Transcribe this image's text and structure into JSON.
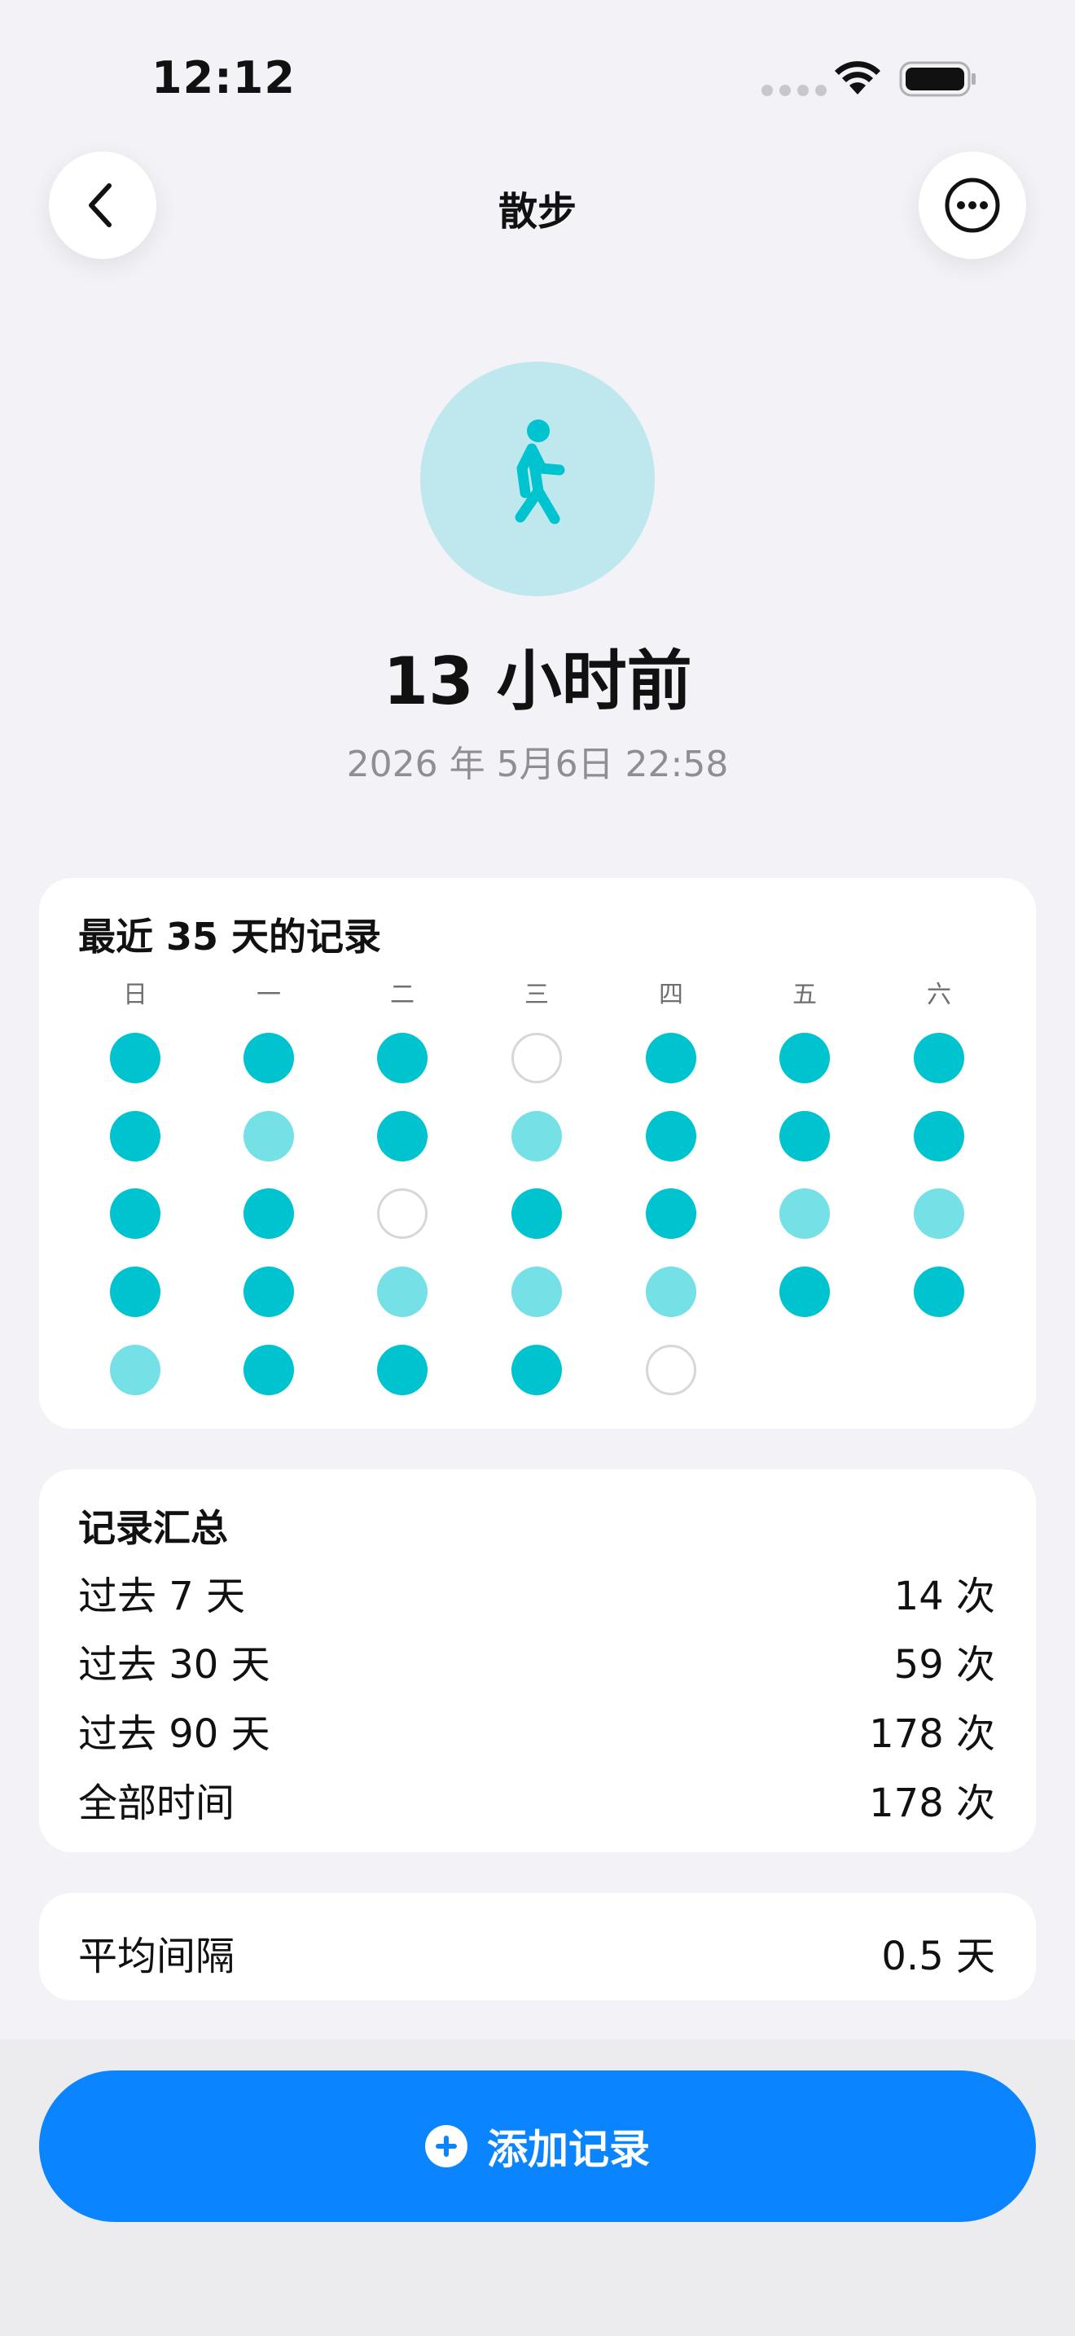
{
  "status_bar": {
    "time": "12:12"
  },
  "nav": {
    "title": "散步"
  },
  "activity": {
    "icon": "walking-person-icon",
    "last_time": "13 小时前",
    "last_date": "2026 年 5月6日 22:58"
  },
  "calendar": {
    "title": "最近 35 天的记录",
    "weekdays": [
      "日",
      "一",
      "二",
      "三",
      "四",
      "五",
      "六"
    ],
    "rows": [
      [
        "full",
        "full",
        "full",
        "empty",
        "full",
        "full",
        "full"
      ],
      [
        "full",
        "light",
        "full",
        "light",
        "full",
        "full",
        "full"
      ],
      [
        "full",
        "full",
        "empty",
        "full",
        "full",
        "light",
        "light"
      ],
      [
        "full",
        "full",
        "light",
        "light",
        "light",
        "full",
        "full"
      ],
      [
        "light",
        "full",
        "full",
        "full",
        "empty"
      ]
    ]
  },
  "summary": {
    "title": "记录汇总",
    "rows": [
      {
        "label": "过去 7 天",
        "value": "14 次"
      },
      {
        "label": "过去 30 天",
        "value": "59 次"
      },
      {
        "label": "过去 90 天",
        "value": "178 次"
      },
      {
        "label": "全部时间",
        "value": "178 次"
      }
    ]
  },
  "interval": {
    "label": "平均间隔",
    "value": "0.5 天"
  },
  "add_button": {
    "label": "添加记录"
  },
  "colors": {
    "accent": "#0a84ff",
    "record_full": "#00c3d0",
    "record_partial": "#76e0e7",
    "icon_bg": "#bfe7ee"
  }
}
